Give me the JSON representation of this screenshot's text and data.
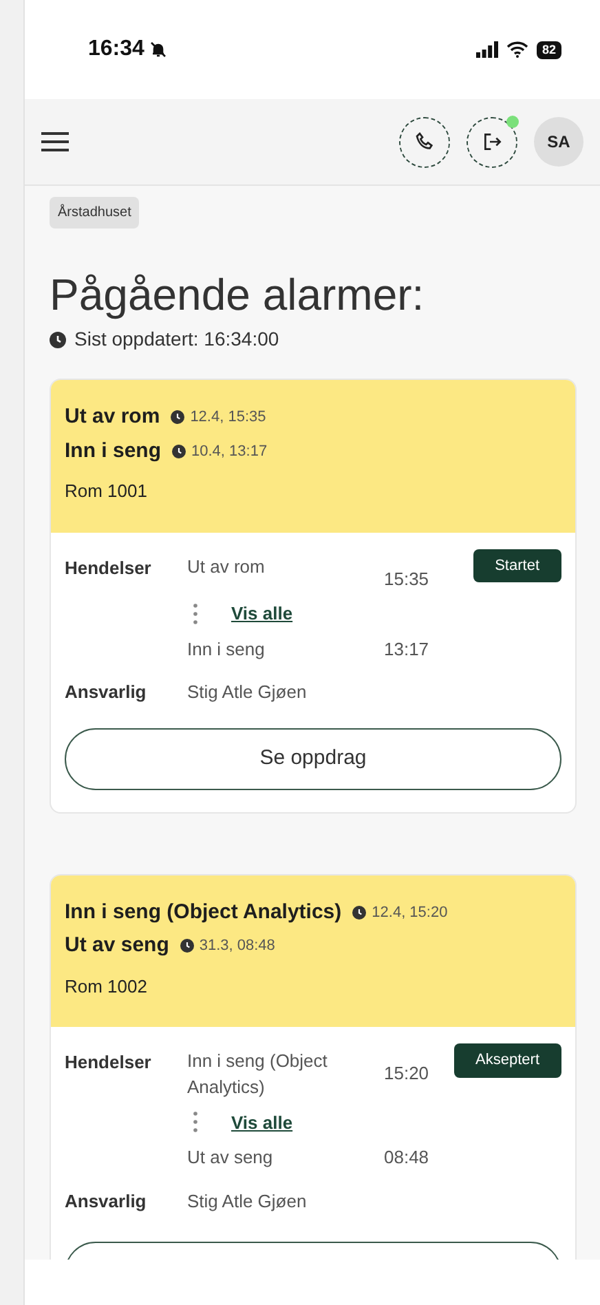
{
  "status_bar": {
    "time": "16:34",
    "battery": "82"
  },
  "header": {
    "avatar": "SA",
    "logout_notification": true
  },
  "location_tag": "Årstadhuset",
  "title": "Pågående alarmer:",
  "updated": "Sist oppdatert: 16:34:00",
  "alarms": [
    {
      "headline": [
        {
          "label": "Ut av rom",
          "time": "12.4, 15:35"
        },
        {
          "label": "Inn i seng",
          "time": "10.4, 13:17"
        }
      ],
      "room": "Rom 1001",
      "events_label": "Hendelser",
      "events": [
        {
          "name": "Ut av rom",
          "time": "15:35"
        },
        {
          "name": "Inn i seng",
          "time": "13:17"
        }
      ],
      "show_all": "Vis alle",
      "status": "Startet",
      "responsible_label": "Ansvarlig",
      "responsible": "Stig Atle Gjøen",
      "button": "Se oppdrag"
    },
    {
      "headline": [
        {
          "label": "Inn i seng (Object Analytics)",
          "time": "12.4, 15:20"
        },
        {
          "label": "Ut av seng",
          "time": "31.3, 08:48"
        }
      ],
      "room": "Rom 1002",
      "events_label": "Hendelser",
      "events": [
        {
          "name": "Inn i seng (Object Analytics)",
          "time": "15:20"
        },
        {
          "name": "Ut av seng",
          "time": "08:48"
        }
      ],
      "show_all": "Vis alle",
      "status": "Akseptert",
      "responsible_label": "Ansvarlig",
      "responsible": "Stig Atle Gjøen"
    }
  ]
}
